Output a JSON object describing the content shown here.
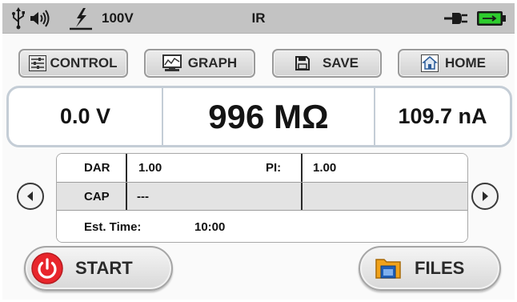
{
  "status_bar": {
    "voltage": "100V",
    "mode": "IR",
    "icons": [
      "usb-icon",
      "speaker-icon",
      "high-voltage-icon",
      "power-plug-icon",
      "battery-charging-icon"
    ],
    "colors": {
      "bar": "#c3c3c3",
      "battery": "#2ecc2e"
    }
  },
  "toolbar": {
    "control_label": "CONTROL",
    "graph_label": "GRAPH",
    "save_label": "SAVE",
    "home_label": "HOME"
  },
  "measurement": {
    "voltage": "0.0 V",
    "resistance": "996 MΩ",
    "current": "109.7 nA"
  },
  "results": {
    "dar_label": "DAR",
    "dar_value": "1.00",
    "pi_label": "PI:",
    "pi_value": "1.00",
    "cap_label": "CAP",
    "cap_value": "---",
    "est_time_label": "Est. Time:",
    "est_time_value": "10:00"
  },
  "actions": {
    "start_label": "START",
    "files_label": "FILES",
    "colors": {
      "start": "#e8262c",
      "files_folder": "#f0a21a",
      "files_window": "#1f5fb8"
    }
  }
}
